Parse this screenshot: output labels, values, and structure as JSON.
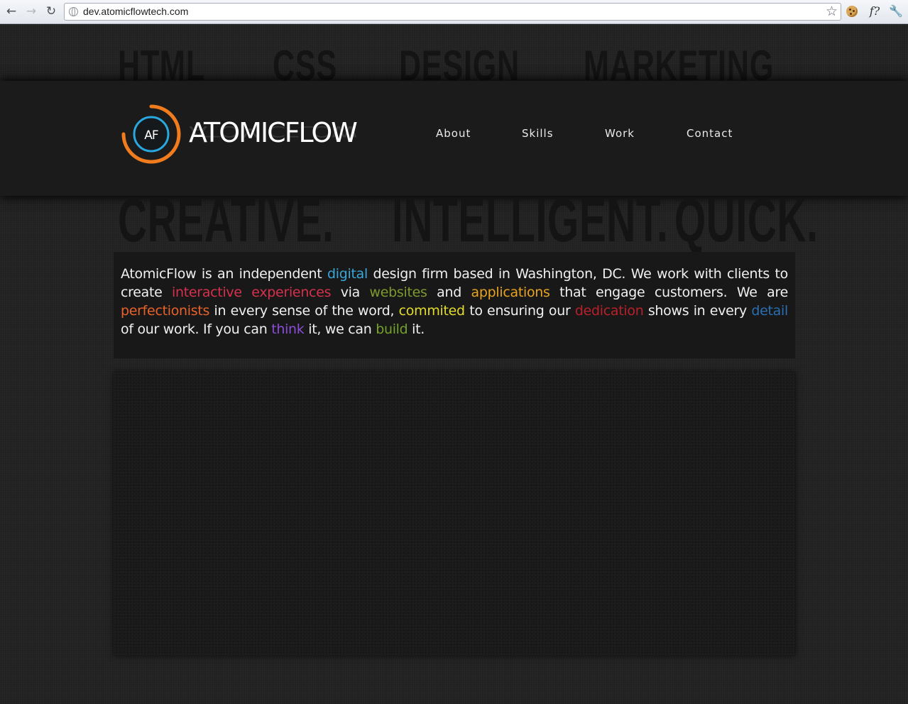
{
  "browser": {
    "back_icon": "arrow-left-icon",
    "forward_icon": "arrow-right-icon",
    "reload_icon": "reload-icon",
    "url": "dev.atomicflowtech.com",
    "bookmark_icon": "star-icon",
    "extension_function_label": "f?",
    "wrench_icon": "wrench-icon"
  },
  "background_words": {
    "top": [
      "HTML",
      "CSS",
      "DESIGN",
      "MARKETING"
    ],
    "bottom": [
      "CREATIVE.",
      "INTELLIGENT.",
      "QUICK."
    ]
  },
  "logo": {
    "mark_text": "AF",
    "brand": "ATOMICFLOW",
    "ring_colors": {
      "outer": "#f07c1e",
      "inner": "#29a8e0"
    }
  },
  "nav": {
    "items": [
      {
        "label": "About"
      },
      {
        "label": "Skills"
      },
      {
        "label": "Work"
      },
      {
        "label": "Contact"
      }
    ]
  },
  "intro": {
    "segments": [
      {
        "text": "AtomicFlow is an independent ",
        "color": "#f0f0f0"
      },
      {
        "text": "digital",
        "color": "#39a7d9"
      },
      {
        "text": " design firm based in Washington, DC. We work with clients to create ",
        "color": "#f0f0f0"
      },
      {
        "text": "interactive experiences",
        "color": "#d6304d"
      },
      {
        "text": " via ",
        "color": "#f0f0f0"
      },
      {
        "text": "websites",
        "color": "#7f9a2c"
      },
      {
        "text": " and ",
        "color": "#f0f0f0"
      },
      {
        "text": "applications",
        "color": "#e8a321"
      },
      {
        "text": " that engage customers. We are ",
        "color": "#f0f0f0"
      },
      {
        "text": "perfectionists",
        "color": "#e8622a"
      },
      {
        "text": " in every sense of the word, ",
        "color": "#f0f0f0"
      },
      {
        "text": "commited",
        "color": "#e3dc2a"
      },
      {
        "text": " to ensuring our ",
        "color": "#f0f0f0"
      },
      {
        "text": "dedication",
        "color": "#b8202a"
      },
      {
        "text": " shows in every ",
        "color": "#f0f0f0"
      },
      {
        "text": "detail",
        "color": "#2a6fb3"
      },
      {
        "text": " of our work. If you can ",
        "color": "#f0f0f0"
      },
      {
        "text": "think",
        "color": "#8a4ed6"
      },
      {
        "text": " it, we can ",
        "color": "#f0f0f0"
      },
      {
        "text": "build",
        "color": "#74a22a"
      },
      {
        "text": " it.",
        "color": "#f0f0f0"
      }
    ]
  }
}
